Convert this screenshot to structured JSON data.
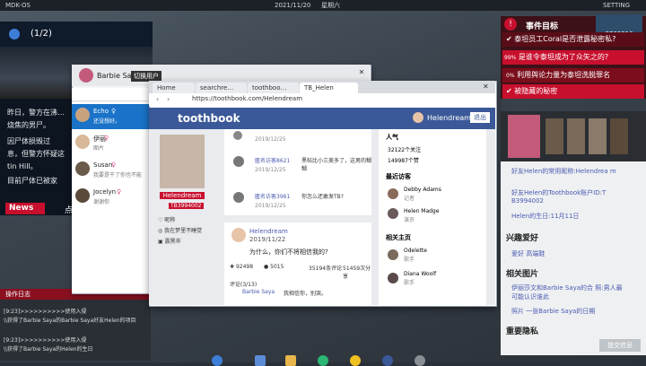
{
  "os": {
    "title": "MDK-OS",
    "date": "2021/11/20",
    "weekday": "星期六",
    "settings_label": "SETTING"
  },
  "news": {
    "header": "(1/2)",
    "paragraphs": [
      "昨日，警方在沸…",
      "烧焦的男尸。",
      "因尸体损毁过",
      "息，但警方怀疑这",
      "tin Hill。",
      "目前尸体已被家"
    ],
    "tag": "News",
    "ticker": "点"
  },
  "log": {
    "title": "操作日志",
    "lines": [
      "[9:23]>>>>>>>>>>使用入侵",
      "\\\\获得了Barbie Saya的Barbie Saya好友Helen的项目",
      "[9:23]>>>>>>>>>>使用入侵",
      "\\\\获得了Barbie Saya的Helen的生日"
    ]
  },
  "chat": {
    "user": "Barbie Saya",
    "switch_label": "切换用户",
    "contacts": [
      {
        "name": "Echo",
        "status": "还没想好。",
        "gender": "♀"
      },
      {
        "name": "伊丽",
        "status": "图片",
        "gender": "♀"
      },
      {
        "name": "Susan",
        "status": "我要是干了你也不能",
        "gender": "♀"
      },
      {
        "name": "Jocelyn",
        "status": "谢谢你",
        "gender": "♀"
      }
    ]
  },
  "browser": {
    "tabs": [
      "Home",
      "searchre…",
      "toothboo…",
      "TB_Helen"
    ],
    "url": "https://toothbook.com/Helendream",
    "site": "toothbook",
    "username": "Helendream",
    "logout": "退出",
    "profile": {
      "name": "Helendream",
      "id": "TB3994002",
      "gender": "昵称",
      "bio": "我在梦里不睡觉",
      "city": "震黑市"
    },
    "comments": [
      {
        "date": "2019/12/25"
      },
      {
        "user": "匿名访客8621",
        "text": "黑帖比小三美多了，这男的糊糊",
        "date": "2019/12/25"
      },
      {
        "user": "匿名访客3961",
        "text": "你怎么还敢发TB?",
        "date": "2019/12/25"
      }
    ],
    "post": {
      "user": "Helendream",
      "date": "2019/11/22",
      "text": "为什么，你们不将相信我的?",
      "likes": "92498",
      "comments": "5015",
      "reposts": "35194条评论",
      "views": "51459次分享",
      "reply_header": "评论(3/13)",
      "reply_user": "Barbie Saya",
      "reply_text": "我相信你，别哭。"
    },
    "side": {
      "popularity": "人气",
      "followers": "32122个关注",
      "likes": "149987个赞",
      "recent_title": "最近访客",
      "recent": [
        {
          "name": "Debby Adams",
          "role": "记者"
        },
        {
          "name": "Helen Madge",
          "role": "演员"
        }
      ],
      "related_title": "相关主页",
      "related": [
        {
          "name": "Odelette",
          "role": "歌手"
        },
        {
          "name": "Diana Woolf",
          "role": "歌手"
        }
      ]
    }
  },
  "tasks": {
    "title": "事件目标",
    "items": [
      {
        "text": "泰坦员工Coral是否泄露秘密私?",
        "pct": ""
      },
      {
        "text": "是谁令泰坦成为了众矢之的?",
        "pct": "99%"
      },
      {
        "text": "利用舆论力量为泰坦洗脱罪名",
        "pct": "0%"
      },
      {
        "text": "被隐藏的秘密",
        "pct": ""
      }
    ],
    "logo_id": "8763210"
  },
  "profile_panel": {
    "facts": [
      "好友Helen的常用昵称:Helendrea m",
      "好友Helen的Toothbook账户ID:T B3994002",
      "Helen的生日:11月11日"
    ],
    "hobby_title": "兴趣爱好",
    "hobby": "爱好 高端鞋",
    "pics_title": "相关图片",
    "pics": [
      "伊丽莎文和Barbie Saya的合 照:男人最可能认识谁此",
      "照片 一张Barbie Saya的日期"
    ],
    "privacy_title": "重要隐私",
    "button": "提交信息"
  },
  "colors": {
    "fb_blue": "#3b5998",
    "task_red": "#c8102e",
    "accent_link": "#4a5ab0"
  }
}
